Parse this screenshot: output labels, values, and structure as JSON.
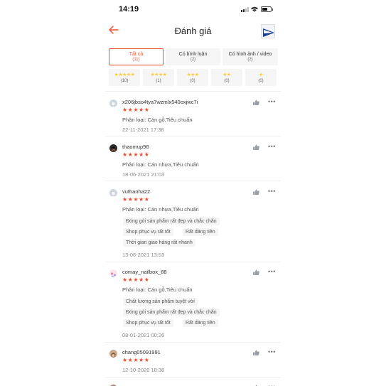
{
  "status": {
    "time": "14:19"
  },
  "header": {
    "title": "Đánh giá",
    "back_icon": "arrow-left-icon",
    "product_icon": "product-thumbnail"
  },
  "colors": {
    "accent": "#ee4d2d",
    "star": "#ffce3d",
    "chip": "#f5f5f5"
  },
  "tabs": [
    {
      "label": "Tất cả",
      "count": "(11)",
      "active": true
    },
    {
      "label": "Có bình luận",
      "count": "(2)",
      "active": false
    },
    {
      "label": "Có hình ảnh / video",
      "count": "(2)",
      "active": false
    }
  ],
  "star_filters": [
    {
      "stars": "★★★★★",
      "count": "(10)"
    },
    {
      "stars": "★★★★",
      "count": "(1)"
    },
    {
      "stars": "★★★",
      "count": "(0)"
    },
    {
      "stars": "★★",
      "count": "(0)"
    },
    {
      "stars": "★",
      "count": "(0)"
    }
  ],
  "reviews": [
    {
      "user": "x206jbso4tya7wzmlx540oxjwc7i",
      "rating": "★★★★★",
      "variant": "Phân loại: Cán gỗ,Tiêu chuẩn",
      "tags": [],
      "date": "22-11-2021 17:38"
    },
    {
      "user": "thaomup96",
      "rating": "★★★★★",
      "variant": "Phân loại: Cán nhựa,Tiêu chuẩn",
      "tags": [],
      "date": "18-06-2021 21:03"
    },
    {
      "user": "vuthanha22",
      "rating": "★★★★★",
      "variant": "Phân loại: Cán nhựa,Tiêu chuẩn",
      "tags": [
        "Đóng gói sản phẩm rất đẹp và chắc chắn",
        "Shop phục vụ rất tốt",
        "Rất đáng tiền",
        "Thời gian giao hàng rất nhanh"
      ],
      "date": "13-06-2021 13:53"
    },
    {
      "user": "comay_nailbox_88",
      "rating": "★★★★★",
      "variant": "Phân loại: Cán gỗ,Tiêu chuẩn",
      "tags": [
        "Chất lượng sản phẩm tuyệt vời",
        "Đóng gói sản phẩm rất đẹp và chắc chắn",
        "Shop phục vụ rất tốt",
        "Rất đáng tiền"
      ],
      "date": "08-01-2021 00:26"
    },
    {
      "user": "chang05091991",
      "rating": "★★★★★",
      "variant": "",
      "tags": [],
      "date": "12-10-2020 18:38"
    }
  ]
}
